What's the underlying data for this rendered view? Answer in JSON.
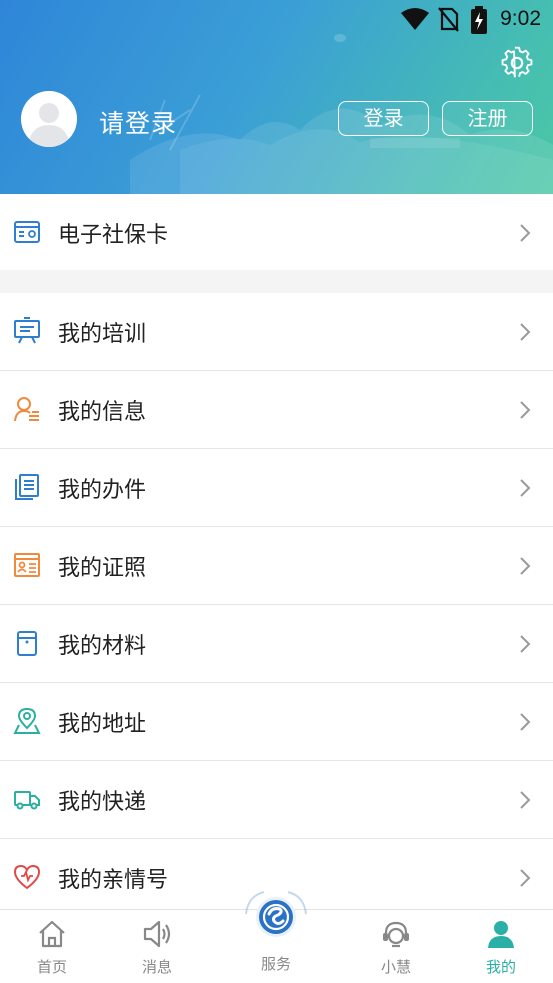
{
  "status_bar": {
    "time": "9:02",
    "icons": [
      "wifi-icon",
      "no-sim-icon",
      "battery-charging-icon"
    ]
  },
  "header": {
    "settings_icon": "gear-icon",
    "avatar_icon": "user-avatar-icon",
    "login_prompt": "请登录",
    "login_button": "登录",
    "register_button": "注册",
    "gradient_colors": [
      "#2f86d8",
      "#4cc7a5"
    ]
  },
  "social_card": {
    "label": "电子社保卡",
    "icon": "social-security-card-icon",
    "icon_color": "#2f7fd0"
  },
  "menu": {
    "items": [
      {
        "label": "我的培训",
        "icon": "training-board-icon",
        "color": "#2f7fd0"
      },
      {
        "label": "我的信息",
        "icon": "user-info-icon",
        "color": "#f08a3c"
      },
      {
        "label": "我的办件",
        "icon": "documents-icon",
        "color": "#2f7fd0"
      },
      {
        "label": "我的证照",
        "icon": "license-card-icon",
        "color": "#f08a3c"
      },
      {
        "label": "我的材料",
        "icon": "folder-icon",
        "color": "#2f7fd0"
      },
      {
        "label": "我的地址",
        "icon": "location-pin-icon",
        "color": "#2bb0a0"
      },
      {
        "label": "我的快递",
        "icon": "delivery-truck-icon",
        "color": "#2bb0a0"
      },
      {
        "label": "我的亲情号",
        "icon": "heart-icon",
        "color": "#e04a4a"
      }
    ]
  },
  "nav": {
    "home": "首页",
    "messages": "消息",
    "service": "服务",
    "assistant": "小慧",
    "mine": "我的",
    "active": "我的",
    "active_color": "#2bb0a8"
  }
}
